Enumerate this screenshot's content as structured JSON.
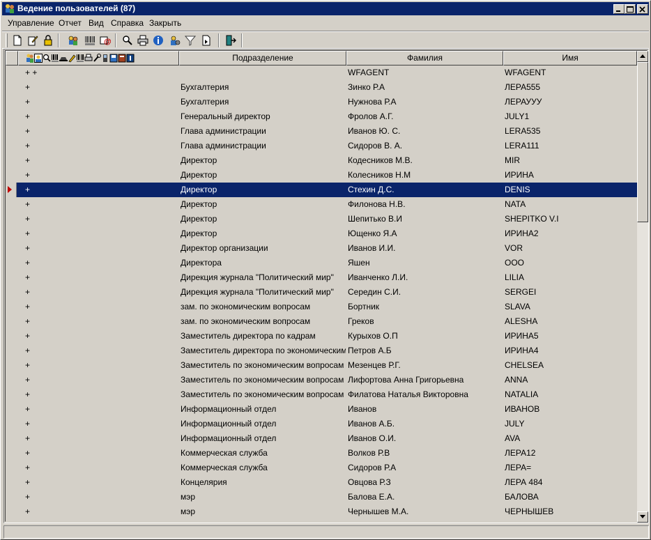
{
  "window": {
    "title": "Ведение пользователей (87)",
    "controls": {
      "minimize": "minimize-icon",
      "maximize": "maximize-icon",
      "close": "close-icon"
    }
  },
  "menu": [
    {
      "label": "Управление"
    },
    {
      "label": "Отчет"
    },
    {
      "label": "Вид"
    },
    {
      "label": "Справка"
    },
    {
      "label": "Закрыть"
    }
  ],
  "toolbar": {
    "buttons": [
      "new-document-icon",
      "edit-icon",
      "lock-icon",
      "users-icon",
      "barcode-icon",
      "email-icon",
      "search-user-icon",
      "print-icon",
      "info-icon",
      "settings-icon",
      "filter-icon",
      "export-icon",
      "exit-icon"
    ]
  },
  "grid": {
    "columns": {
      "dept": "Подразделение",
      "last_name": "Фамилия",
      "first_name": "Имя"
    },
    "selected_index": 8,
    "rows": [
      {
        "plus": "+ +",
        "dept": "",
        "last": "WFAGENT",
        "first": "WFAGENT"
      },
      {
        "plus": "+",
        "dept": "Бухгалтерия",
        "last": "Зинко Р.А",
        "first": "ЛЕРА555"
      },
      {
        "plus": "+",
        "dept": "Бухгалтерия",
        "last": "Нужнова Р.А",
        "first": "ЛЕРАУУУ"
      },
      {
        "plus": "+",
        "dept": "Генеральный директор",
        "last": "Фролов А.Г.",
        "first": "JULY1"
      },
      {
        "plus": "+",
        "dept": "Глава администрации",
        "last": "Иванов Ю. С.",
        "first": "LERA535"
      },
      {
        "plus": "+",
        "dept": "Глава администрации",
        "last": "Сидоров В. А.",
        "first": "LERA111"
      },
      {
        "plus": "+",
        "dept": "Директор",
        "last": "Кодесников М.В.",
        "first": "MIR"
      },
      {
        "plus": "+",
        "dept": "Директор",
        "last": "Колесников Н.М",
        "first": "ИРИНА"
      },
      {
        "plus": "+",
        "dept": "Директор",
        "last": "Стехин Д.С.",
        "first": "DENIS"
      },
      {
        "plus": "+",
        "dept": "Директор",
        "last": "Филонова Н.В.",
        "first": "NATA"
      },
      {
        "plus": "+",
        "dept": "Директор",
        "last": "Шепитько В.И",
        "first": "SHEPITKO V.I"
      },
      {
        "plus": "+",
        "dept": "Директор",
        "last": "Ющенко Я.А",
        "first": "ИРИНА2"
      },
      {
        "plus": "+",
        "dept": "Директор организации",
        "last": "Иванов И.И.",
        "first": "VOR"
      },
      {
        "plus": "+",
        "dept": "Директора",
        "last": "Яшен",
        "first": "OOO"
      },
      {
        "plus": "+",
        "dept": "Дирекция журнала \"Политический мир\"",
        "last": "Иванченко Л.И.",
        "first": "LILIA"
      },
      {
        "plus": "+",
        "dept": "Дирекция журнала \"Политический мир\"",
        "last": "Середин С.И.",
        "first": "SERGEI"
      },
      {
        "plus": "+",
        "dept": "зам. по экономическим вопросам",
        "last": "Бортник",
        "first": "SLAVA"
      },
      {
        "plus": "+",
        "dept": "зам. по экономическим вопросам",
        "last": "Греков",
        "first": "ALESHA"
      },
      {
        "plus": "+",
        "dept": "Заместитель директора по кадрам",
        "last": "Курыхов О.П",
        "first": "ИРИНА5"
      },
      {
        "plus": "+",
        "dept": "Заместитель директора по экономическим",
        "last": "Петров А.Б",
        "first": "ИРИНА4"
      },
      {
        "plus": "+",
        "dept": "Заместитель по экономическим вопросам",
        "last": "Мезенцев Р.Г.",
        "first": "CHELSEA"
      },
      {
        "plus": "+",
        "dept": "Заместитель по экономическим вопросам",
        "last": "Лифортова Анна Григорьевна",
        "first": "ANNA"
      },
      {
        "plus": "+",
        "dept": "Заместитель по экономическим вопросам",
        "last": "Филатова Наталья Викторовна",
        "first": "NATALIA"
      },
      {
        "plus": "+",
        "dept": "Информационный отдел",
        "last": "Иванов",
        "first": "ИВАНОВ"
      },
      {
        "plus": "+",
        "dept": "Информационный отдел",
        "last": "Иванов А.Б.",
        "first": "JULY"
      },
      {
        "plus": "+",
        "dept": "Информационный отдел",
        "last": "Иванов О.И.",
        "first": "AVA"
      },
      {
        "plus": "+",
        "dept": "Коммерческая служба",
        "last": "Волков Р.В",
        "first": "ЛЕРА12"
      },
      {
        "plus": "+",
        "dept": "Коммерческая служба",
        "last": "Сидоров Р.А",
        "first": "ЛЕРА="
      },
      {
        "plus": "+",
        "dept": "Концелярия",
        "last": "Овцова Р.З",
        "first": "ЛЕРА 484"
      },
      {
        "plus": "+",
        "dept": "мэр",
        "last": "Балова   Е.А.",
        "first": "БАЛОВА"
      },
      {
        "plus": "+",
        "dept": "мэр",
        "last": "Чернышев М.А.",
        "first": "ЧЕРНЫШЕВ"
      }
    ]
  },
  "colors": {
    "titlebar": "#0a246a",
    "selection": "#0a246a",
    "face": "#d4d0c8"
  }
}
